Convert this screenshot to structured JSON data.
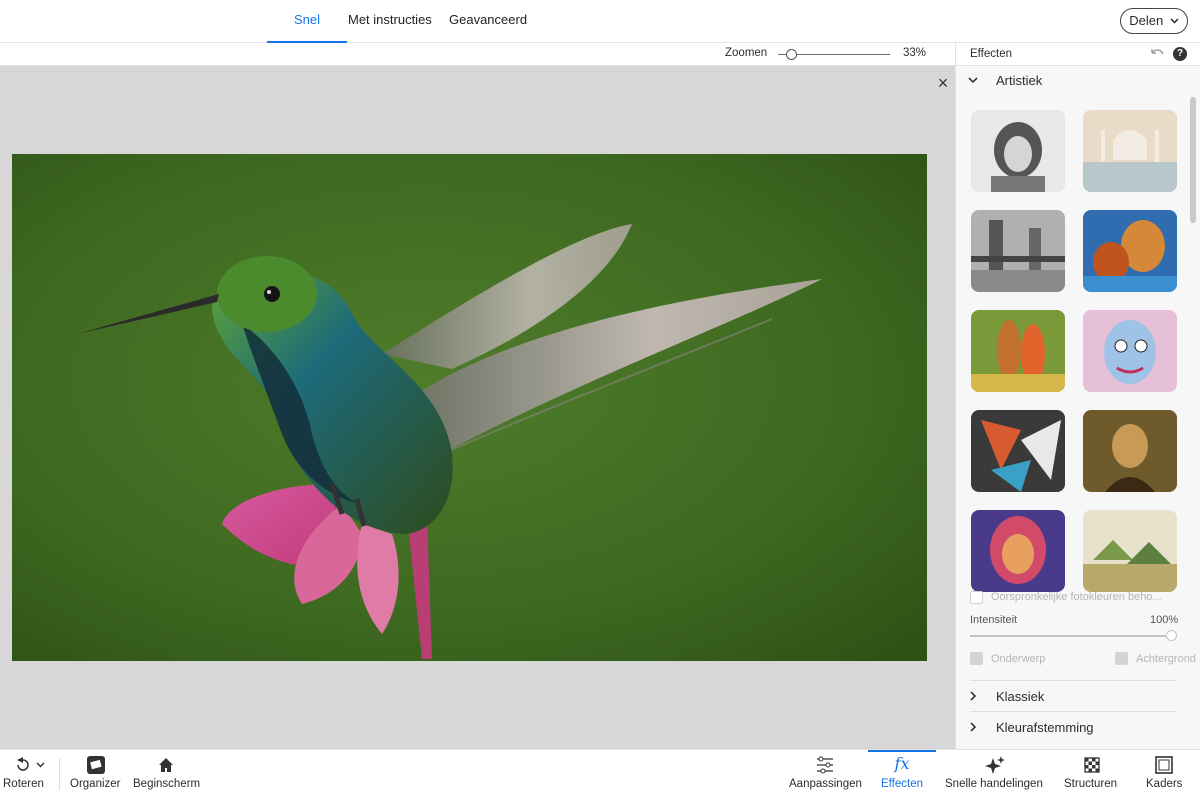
{
  "topbar": {
    "tabs": [
      {
        "label": "Snel",
        "active": true
      },
      {
        "label": "Met instructies"
      },
      {
        "label": "Geavanceerd"
      }
    ],
    "share_label": "Delen",
    "share_icon": "chevron-down-icon"
  },
  "zoom": {
    "label": "Zoomen",
    "value": "33%",
    "level_percent": 33
  },
  "canvas": {
    "close_icon": "close-icon",
    "image": "hummingbird-photo"
  },
  "panel": {
    "title": "Effecten",
    "undo_icon": "undo-icon",
    "help_icon": "help-icon",
    "help_symbol": "?",
    "section_open": "Artistiek",
    "thumbnails": [
      "portrait-sketch-effect",
      "taj-mahal-effect",
      "tower-bridge-effect",
      "pop-art-portrait-effect",
      "gauguin-style-effect",
      "cubist-face-effect",
      "abstract-shapes-effect",
      "mona-lisa-effect",
      "colorful-portrait-effect",
      "village-painting-effect"
    ],
    "preserve_colors_label": "Oorspronkelijke fotokleuren beho...",
    "intensity_label": "Intensiteit",
    "intensity_value": "100%",
    "intensity_level_percent": 100,
    "subject_label": "Onderwerp",
    "background_label": "Achtergrond",
    "collapsed_sections": [
      "Klassiek",
      "Kleurafstemming"
    ]
  },
  "bottombar": {
    "left": [
      {
        "label": "Roteren",
        "icon": "rotate-icon"
      },
      {
        "label": "Organizer",
        "icon": "organizer-icon"
      },
      {
        "label": "Beginscherm",
        "icon": "home-icon"
      }
    ],
    "right": [
      {
        "label": "Aanpassingen",
        "icon": "sliders-icon"
      },
      {
        "label": "Effecten",
        "icon": "fx-icon",
        "active": true
      },
      {
        "label": "Snelle handelingen",
        "icon": "sparkle-icon"
      },
      {
        "label": "Structuren",
        "icon": "texture-icon"
      },
      {
        "label": "Kaders",
        "icon": "frame-icon"
      }
    ]
  },
  "colors": {
    "accent": "#1473e6",
    "canvas_bg": "#d7d7d7",
    "photo_bg": "#3f6a22"
  }
}
